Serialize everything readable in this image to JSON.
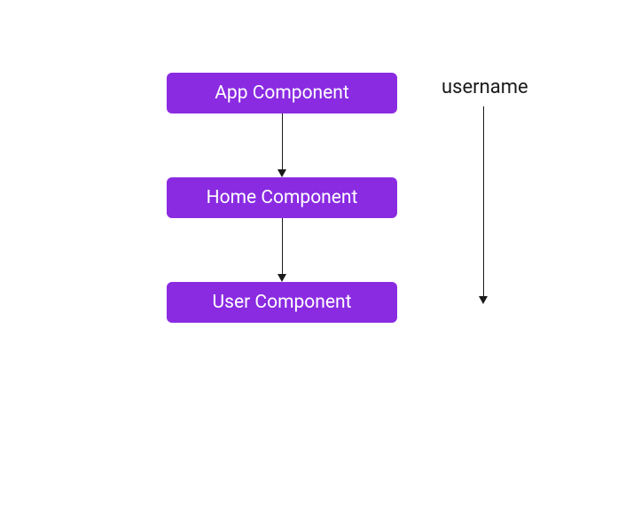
{
  "colors": {
    "node_fill": "#8a2be2",
    "node_text": "#ffffff",
    "arrow": "#1a1a1a",
    "annotation": "#1a1a1a"
  },
  "nodes": {
    "app": "App Component",
    "home": "Home Component",
    "user": "User Component"
  },
  "annotation": {
    "username": "username"
  }
}
